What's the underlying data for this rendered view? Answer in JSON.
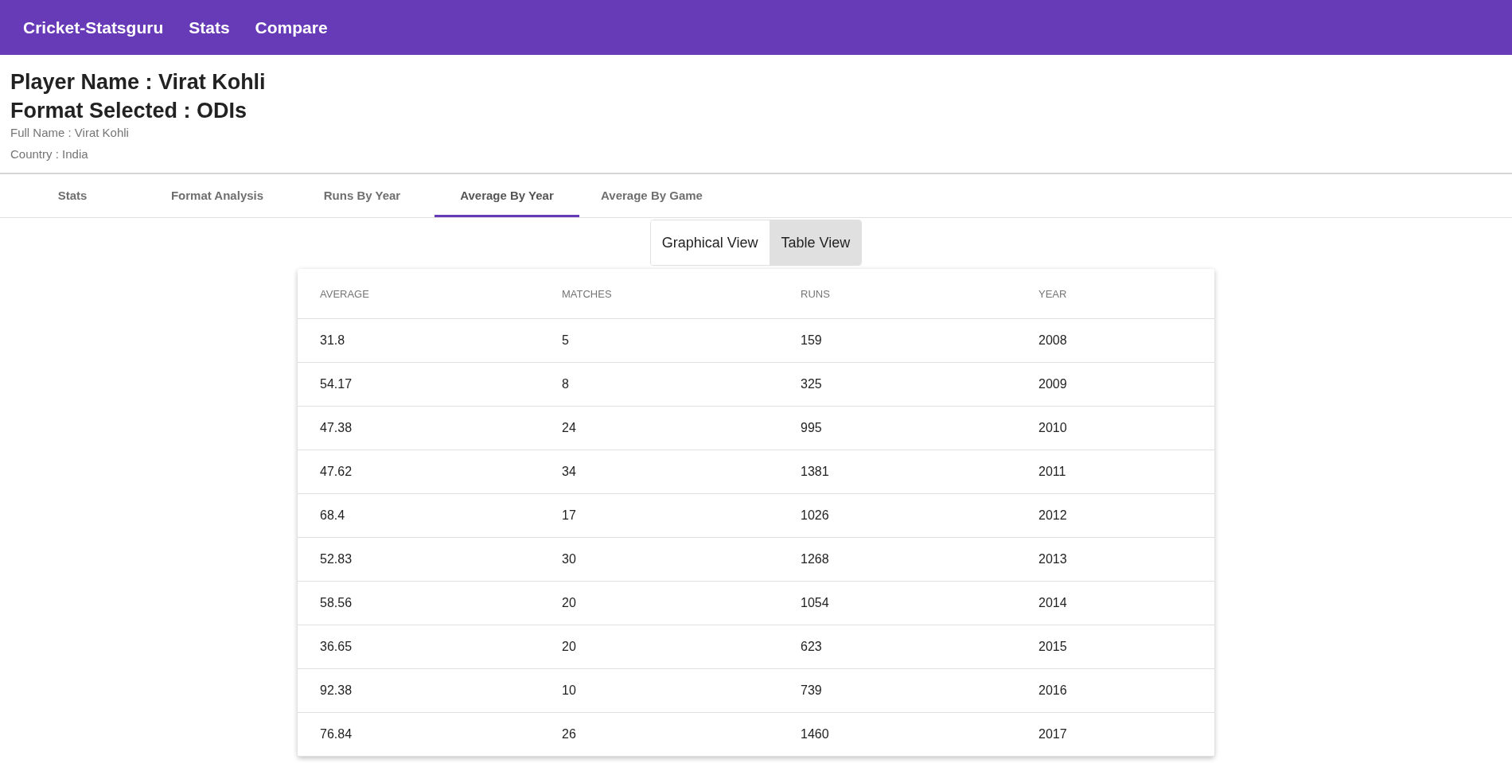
{
  "navbar": {
    "brand": "Cricket-Statsguru",
    "links": [
      "Stats",
      "Compare"
    ]
  },
  "player": {
    "name_line": "Player Name : Virat Kohli",
    "format_line": "Format Selected : ODIs",
    "full_name": "Full Name : Virat Kohli",
    "country": "Country : India"
  },
  "tabs": [
    {
      "label": "Stats",
      "selected": false
    },
    {
      "label": "Format Analysis",
      "selected": false
    },
    {
      "label": "Runs By Year",
      "selected": false
    },
    {
      "label": "Average By Year",
      "selected": true
    },
    {
      "label": "Average By Game",
      "selected": false
    }
  ],
  "view_toggle": [
    {
      "label": "Graphical View",
      "selected": false
    },
    {
      "label": "Table View",
      "selected": true
    }
  ],
  "table": {
    "columns": [
      "AVERAGE",
      "MATCHES",
      "RUNS",
      "YEAR"
    ],
    "rows": [
      [
        "31.8",
        "5",
        "159",
        "2008"
      ],
      [
        "54.17",
        "8",
        "325",
        "2009"
      ],
      [
        "47.38",
        "24",
        "995",
        "2010"
      ],
      [
        "47.62",
        "34",
        "1381",
        "2011"
      ],
      [
        "68.4",
        "17",
        "1026",
        "2012"
      ],
      [
        "52.83",
        "30",
        "1268",
        "2013"
      ],
      [
        "58.56",
        "20",
        "1054",
        "2014"
      ],
      [
        "36.65",
        "20",
        "623",
        "2015"
      ],
      [
        "92.38",
        "10",
        "739",
        "2016"
      ],
      [
        "76.84",
        "26",
        "1460",
        "2017"
      ]
    ]
  }
}
